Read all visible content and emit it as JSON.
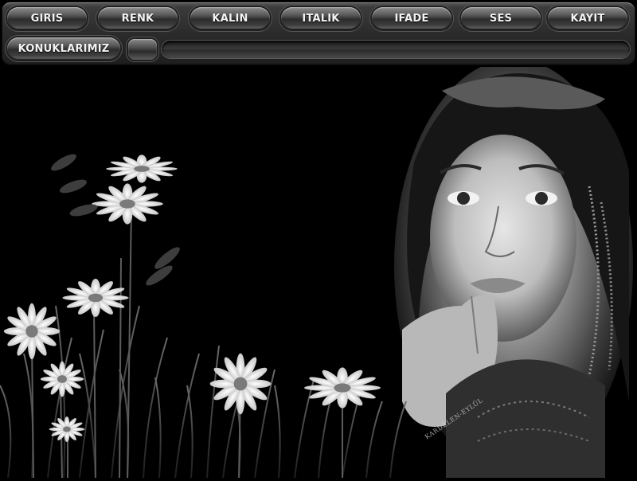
{
  "toolbar": {
    "row1": [
      "GIRIS",
      "RENK",
      "KALIN",
      "ITALIK",
      "IFADE",
      "SES",
      "KAYIT"
    ],
    "row2": [
      "KONUKLARIMIZ"
    ]
  },
  "watermark": "KARDELEN-EYLÜL",
  "colors": {
    "background": "#000000",
    "chrome": "#2b2b2b",
    "button_text": "#f2f2f2"
  },
  "icons": {
    "square_button": "blank-square-button",
    "progress_slot": "empty-track"
  }
}
